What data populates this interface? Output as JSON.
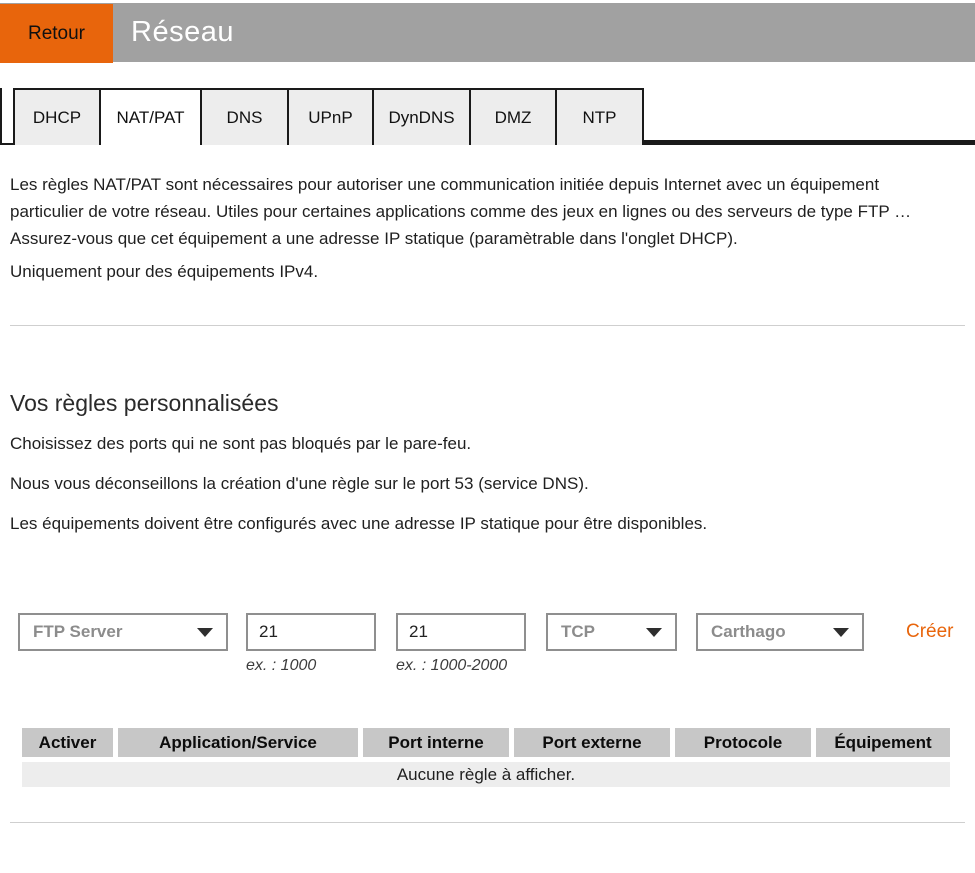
{
  "header": {
    "back_label": "Retour",
    "title": "Réseau"
  },
  "tabs": [
    {
      "label": "DHCP",
      "active": false
    },
    {
      "label": "NAT/PAT",
      "active": true
    },
    {
      "label": "DNS",
      "active": false
    },
    {
      "label": "UPnP",
      "active": false
    },
    {
      "label": "DynDNS",
      "active": false
    },
    {
      "label": "DMZ",
      "active": false
    },
    {
      "label": "NTP",
      "active": false
    }
  ],
  "intro": {
    "paragraph1": "Les règles NAT/PAT sont nécessaires pour autoriser une communication initiée depuis Internet avec un équipement particulier de votre réseau. Utiles pour certaines applications comme des jeux en lignes ou des serveurs de type FTP … Assurez-vous que cet équipement a une adresse IP statique (paramètrable dans l'onglet DHCP).",
    "paragraph2": "Uniquement pour des équipements IPv4."
  },
  "rules_section": {
    "heading": "Vos règles personnalisées",
    "hints": [
      "Choisissez des ports qui ne sont pas bloqués par le pare-feu.",
      "Nous vous déconseillons la création d'une règle sur le port 53 (service DNS).",
      "Les équipements doivent être configurés avec une adresse IP statique pour être disponibles."
    ]
  },
  "form": {
    "application_select": {
      "value": "FTP Server"
    },
    "internal_port": {
      "value": "21",
      "hint": "ex. : 1000"
    },
    "external_port": {
      "value": "21",
      "hint": "ex. : 1000-2000"
    },
    "protocol_select": {
      "value": "TCP"
    },
    "device_select": {
      "value": "Carthago"
    },
    "create_label": "Créer"
  },
  "table": {
    "columns": [
      "Activer",
      "Application/Service",
      "Port interne",
      "Port externe",
      "Protocole",
      "Équipement"
    ],
    "empty_message": "Aucune règle à afficher."
  },
  "colors": {
    "accent_orange": "#e8650c",
    "header_gray": "#a1a1a1",
    "tab_inactive_bg": "#ededed",
    "table_header_bg": "#c7c7c7",
    "table_empty_bg": "#ededed",
    "divider": "#cfcfcf"
  }
}
